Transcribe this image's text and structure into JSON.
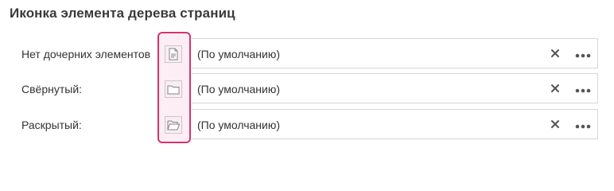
{
  "section": {
    "title": "Иконка элемента дерева страниц"
  },
  "rows": [
    {
      "label": "Нет дочерних элементов",
      "value": "(По умолчанию)",
      "icon": "document-icon"
    },
    {
      "label": "Свёрнутый:",
      "value": "(По умолчанию)",
      "icon": "folder-closed-icon"
    },
    {
      "label": "Раскрытый:",
      "value": "(По умолчанию)",
      "icon": "folder-open-icon"
    }
  ],
  "colors": {
    "highlight_border": "#d6336c",
    "highlight_fill": "#fcdeec"
  }
}
